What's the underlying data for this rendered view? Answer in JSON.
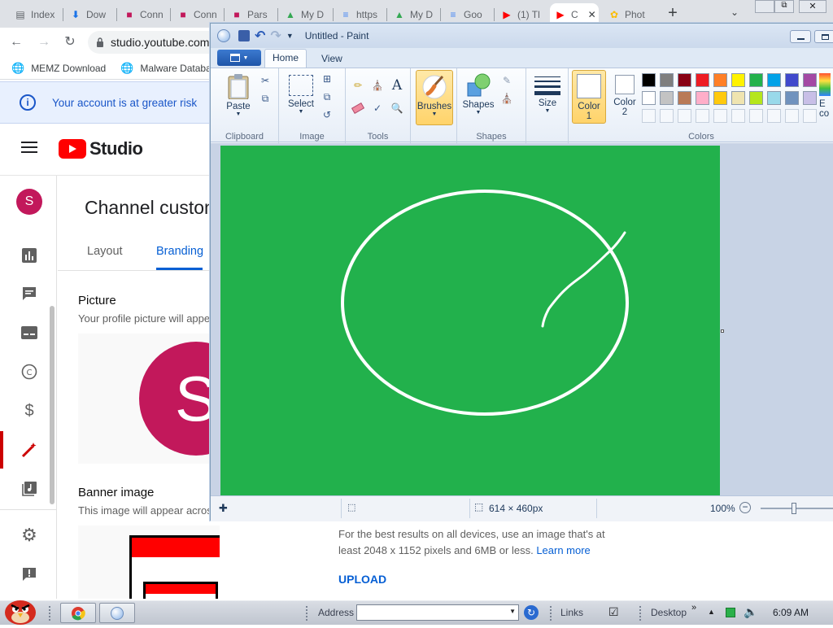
{
  "browser": {
    "tabs": [
      {
        "label": "Index",
        "icon": "document-icon",
        "color": "#5f6368"
      },
      {
        "label": "Dow",
        "icon": "download-icon",
        "color": "#1a73e8"
      },
      {
        "label": "Conn",
        "icon": "bookmark-icon",
        "color": "#c2185b"
      },
      {
        "label": "Conn",
        "icon": "bookmark-icon",
        "color": "#c2185b"
      },
      {
        "label": "Pars",
        "icon": "bookmark-icon",
        "color": "#c2185b"
      },
      {
        "label": "My D",
        "icon": "drive-icon",
        "color": "#34a853"
      },
      {
        "label": "https",
        "icon": "docs-icon",
        "color": "#4285f4"
      },
      {
        "label": "My D",
        "icon": "drive-icon",
        "color": "#34a853"
      },
      {
        "label": "Goo",
        "icon": "docs-icon",
        "color": "#4285f4"
      },
      {
        "label": "(1) Tl",
        "icon": "youtube-icon",
        "color": "#ff0000"
      },
      {
        "label": "C",
        "icon": "youtube-icon",
        "color": "#ff0000"
      },
      {
        "label": "Phot",
        "icon": "photos-icon",
        "color": "#fbbc04"
      }
    ],
    "new_tab": "+",
    "url": "studio.youtube.com",
    "bookmarks": [
      "MEMZ Download",
      "Malware Databa"
    ],
    "warning": "Your account is at greater risk"
  },
  "youtube": {
    "logo_text": "Studio",
    "avatar_letter": "S",
    "page_title": "Channel custom",
    "tabs": [
      "Layout",
      "Branding"
    ],
    "picture_heading": "Picture",
    "picture_desc": "Your profile picture will appe",
    "profile_letter": "S",
    "banner_heading": "Banner image",
    "banner_desc": "This image will appear acros",
    "banner_help": "For the best results on all devices, use an image that's at",
    "banner_help2": "least 2048 x 1152 pixels and 6MB or less.",
    "learn_more": "Learn more",
    "upload": "UPLOAD"
  },
  "paint": {
    "title": "Untitled - Paint",
    "tabs": [
      "Home",
      "View"
    ],
    "groups": [
      "Clipboard",
      "Image",
      "Tools",
      "Shapes",
      "Colors"
    ],
    "buttons": {
      "paste": "Paste",
      "select": "Select",
      "brushes": "Brushes",
      "shapes": "Shapes",
      "size": "Size",
      "color1": "Color",
      "color1_num": "1",
      "color2": "Color",
      "color2_num": "2",
      "edit_colors": "E",
      "edit_colors2": "co"
    },
    "palette_row1": [
      "#000000",
      "#7f7f7f",
      "#880015",
      "#ed1c24",
      "#ff7f27",
      "#fff200",
      "#22b14c",
      "#00a2e8",
      "#3f48cc",
      "#a349a4"
    ],
    "palette_row2": [
      "#ffffff",
      "#c3c3c3",
      "#b97a57",
      "#ffaec9",
      "#ffc90e",
      "#efe4b0",
      "#b5e61d",
      "#99d9ea",
      "#7092be",
      "#c8bfe7"
    ],
    "canvas_color": "#22b14c",
    "status_size": "614 × 460px",
    "zoom": "100%"
  },
  "taskbar": {
    "address_label": "Address",
    "links": "Links",
    "desktop": "Desktop",
    "clock": "6:09 AM"
  }
}
